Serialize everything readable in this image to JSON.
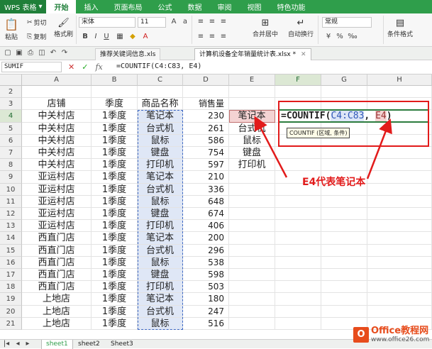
{
  "app": {
    "name": "WPS 表格",
    "menu_tabs": [
      "开始",
      "插入",
      "页面布局",
      "公式",
      "数据",
      "审阅",
      "视图",
      "特色功能"
    ],
    "active_tab": "开始"
  },
  "ribbon": {
    "cut": "剪切",
    "copy": "复制",
    "format_painter": "格式刷",
    "paste": "粘贴",
    "font_name": "宋体",
    "font_size": "11",
    "merge_center": "合并居中",
    "wrap_text": "自动换行",
    "number_format": "常规",
    "conditional_format": "条件格式"
  },
  "file_tabs": [
    {
      "label": "推荐关键词信息.xls",
      "active": false
    },
    {
      "label": "计算机设备全年销量统计表.xlsx *",
      "active": true
    }
  ],
  "formula_bar": {
    "name_box": "SUMIF",
    "cancel_icon": "✕",
    "confirm_icon": "✓",
    "fx": "fx",
    "formula": "=COUNTIF(C4:C83, E4)"
  },
  "columns": [
    "A",
    "B",
    "C",
    "D",
    "E",
    "F",
    "G",
    "H"
  ],
  "rows": [
    {
      "n": "2",
      "A": "",
      "B": "",
      "C": "",
      "D": "",
      "E": ""
    },
    {
      "n": "3",
      "A": "店铺",
      "B": "季度",
      "C": "商品名称",
      "D": "销售量",
      "E": ""
    },
    {
      "n": "4",
      "A": "中关村店",
      "B": "1季度",
      "C": "笔记本",
      "D": "230",
      "E": "笔记本"
    },
    {
      "n": "5",
      "A": "中关村店",
      "B": "1季度",
      "C": "台式机",
      "D": "261",
      "E": "台式机"
    },
    {
      "n": "6",
      "A": "中关村店",
      "B": "1季度",
      "C": "鼠标",
      "D": "586",
      "E": "鼠标"
    },
    {
      "n": "7",
      "A": "中关村店",
      "B": "1季度",
      "C": "键盘",
      "D": "754",
      "E": "键盘"
    },
    {
      "n": "8",
      "A": "中关村店",
      "B": "1季度",
      "C": "打印机",
      "D": "597",
      "E": "打印机"
    },
    {
      "n": "9",
      "A": "亚运村店",
      "B": "1季度",
      "C": "笔记本",
      "D": "210",
      "E": ""
    },
    {
      "n": "10",
      "A": "亚运村店",
      "B": "1季度",
      "C": "台式机",
      "D": "336",
      "E": ""
    },
    {
      "n": "11",
      "A": "亚运村店",
      "B": "1季度",
      "C": "鼠标",
      "D": "648",
      "E": ""
    },
    {
      "n": "12",
      "A": "亚运村店",
      "B": "1季度",
      "C": "键盘",
      "D": "674",
      "E": ""
    },
    {
      "n": "13",
      "A": "亚运村店",
      "B": "1季度",
      "C": "打印机",
      "D": "406",
      "E": ""
    },
    {
      "n": "14",
      "A": "西直门店",
      "B": "1季度",
      "C": "笔记本",
      "D": "200",
      "E": ""
    },
    {
      "n": "15",
      "A": "西直门店",
      "B": "1季度",
      "C": "台式机",
      "D": "296",
      "E": ""
    },
    {
      "n": "16",
      "A": "西直门店",
      "B": "1季度",
      "C": "鼠标",
      "D": "538",
      "E": ""
    },
    {
      "n": "17",
      "A": "西直门店",
      "B": "1季度",
      "C": "键盘",
      "D": "598",
      "E": ""
    },
    {
      "n": "18",
      "A": "西直门店",
      "B": "1季度",
      "C": "打印机",
      "D": "503",
      "E": ""
    },
    {
      "n": "19",
      "A": "上地店",
      "B": "1季度",
      "C": "笔记本",
      "D": "180",
      "E": ""
    },
    {
      "n": "20",
      "A": "上地店",
      "B": "1季度",
      "C": "台式机",
      "D": "247",
      "E": ""
    },
    {
      "n": "21",
      "A": "上地店",
      "B": "1季度",
      "C": "鼠标",
      "D": "516",
      "E": ""
    }
  ],
  "active_cell_formula": {
    "prefix": "=COUNTIF(",
    "ref1": "C4:C83",
    "sep": ", ",
    "ref2": "E4",
    "suffix": ")"
  },
  "tooltip": "COUNTIF (区域, 条件)",
  "annotation": "E4代表笔记本",
  "sheets": [
    "sheet1",
    "sheet2",
    "Sheet3"
  ],
  "active_sheet": "sheet1",
  "watermark": {
    "box": "O",
    "line1": "Office教程网",
    "line2": "www.office26.com"
  },
  "colors": {
    "accent": "#2f9e4b",
    "annotation_red": "#e21b1b",
    "range_blue": "#3a66c4"
  }
}
